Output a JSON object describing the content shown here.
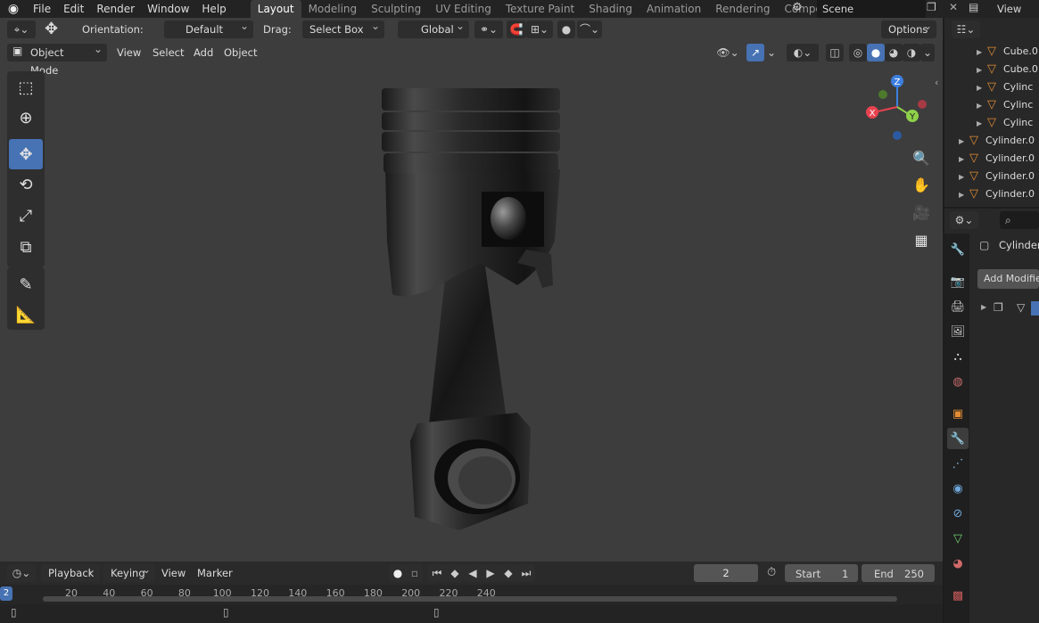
{
  "menu": {
    "items": [
      "File",
      "Edit",
      "Render",
      "Window",
      "Help"
    ]
  },
  "workspaces": {
    "tabs": [
      "Layout",
      "Modeling",
      "Sculpting",
      "UV Editing",
      "Texture Paint",
      "Shading",
      "Animation",
      "Rendering",
      "Compositing"
    ],
    "active": "Layout"
  },
  "scene": {
    "name": "Scene",
    "view_layer": "View Lay"
  },
  "tool_header": {
    "orientation_label": "Orientation:",
    "orientation_value": "Default",
    "drag_label": "Drag:",
    "drag_value": "Select Box",
    "transform_space": "Global",
    "options_label": "Options"
  },
  "view_header": {
    "mode": "Object Mode",
    "menus": [
      "View",
      "Select",
      "Add",
      "Object"
    ]
  },
  "outliner": {
    "rows": [
      {
        "name": "Cube.0",
        "indent": 2
      },
      {
        "name": "Cube.0",
        "indent": 2
      },
      {
        "name": "Cylinc",
        "indent": 2
      },
      {
        "name": "Cylinc",
        "indent": 2
      },
      {
        "name": "Cylinc",
        "indent": 2
      },
      {
        "name": "Cylinder.0",
        "indent": 1
      },
      {
        "name": "Cylinder.0",
        "indent": 1
      },
      {
        "name": "Cylinder.0",
        "indent": 1
      },
      {
        "name": "Cylinder.0",
        "indent": 1
      }
    ]
  },
  "properties": {
    "object_name": "Cylinder.",
    "add_modifier_label": "Add Modifier"
  },
  "timeline": {
    "menus": [
      "Playback",
      "Keying",
      "View",
      "Marker"
    ],
    "current_frame": "2",
    "start_label": "Start",
    "start_value": "1",
    "end_label": "End",
    "end_value": "250",
    "ruler_ticks": [
      "20",
      "40",
      "60",
      "80",
      "100",
      "120",
      "140",
      "160",
      "180",
      "200",
      "220",
      "240"
    ],
    "playhead": "2"
  },
  "colors": {
    "accent": "#4772b3",
    "axis_x": "#e8424f",
    "axis_y": "#8fd14a",
    "axis_z": "#3d7fe0",
    "object_icon": "#e28c34"
  }
}
